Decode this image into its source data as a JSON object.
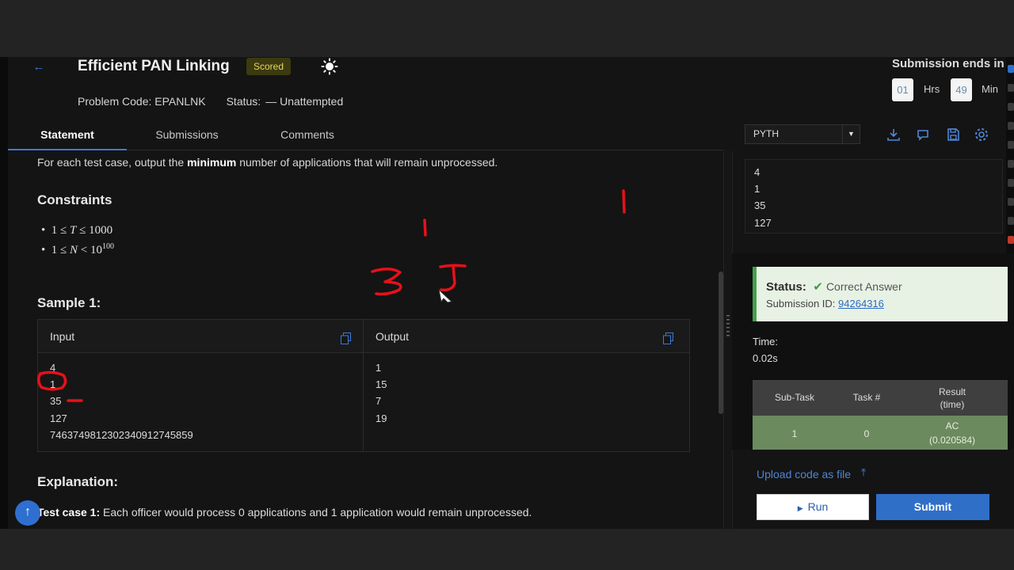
{
  "header": {
    "title": "Efficient PAN Linking",
    "badge": "Scored",
    "problem_code": "Problem Code: EPANLNK",
    "status_label": "Status:",
    "status_value": "— Unattempted"
  },
  "timer": {
    "caption": "Submission ends in",
    "hours": "01",
    "hours_unit": "Hrs",
    "minutes": "49",
    "minutes_unit": "Min"
  },
  "tabs": [
    {
      "label": "Statement",
      "active": true
    },
    {
      "label": "Submissions",
      "active": false
    },
    {
      "label": "Comments",
      "active": false
    }
  ],
  "statement": {
    "output_pre": "For each test case, output the ",
    "output_bold": "minimum",
    "output_post": " number of applications that will remain unprocessed.",
    "constraints_title": "Constraints",
    "constraints": [
      {
        "lead": "1 ≤ ",
        "var": "T",
        "tail": " ≤ 1000",
        "sup": ""
      },
      {
        "lead": "1 ≤ ",
        "var": "N",
        "tail": " < 10",
        "sup": "100"
      }
    ],
    "sample_title": "Sample 1:",
    "input_label": "Input",
    "output_label": "Output",
    "input_lines": [
      "4",
      "1",
      "35",
      "127",
      "746374981230234091274585​9"
    ],
    "output_lines": [
      "1",
      "15",
      "7",
      "19"
    ],
    "explanation_title": "Explanation:",
    "explanation_bold": "Test case 1:",
    "explanation_text": " Each officer would process 0 applications and 1 application would remain unprocessed."
  },
  "editor": {
    "language": "PYTH",
    "custom_input": [
      "4",
      "1",
      "35",
      "127"
    ]
  },
  "result": {
    "status_label": "Status:",
    "status_value": "Correct Answer",
    "submission_label": "Submission ID: ",
    "submission_id": "94264316",
    "time_label": "Time:",
    "time_value": "0.02s",
    "table_headers": [
      "Sub-Task",
      "Task #",
      "Result\n(time)"
    ],
    "rows": [
      [
        "1",
        "0",
        "AC",
        "(0.020584)"
      ]
    ]
  },
  "actions": {
    "upload_label": "Upload code as file",
    "run_label": "Run",
    "submit_label": "Submit"
  },
  "colors": {
    "accent": "#2f6fc8",
    "success": "#42a04a",
    "annotation_red": "#e8101a"
  }
}
